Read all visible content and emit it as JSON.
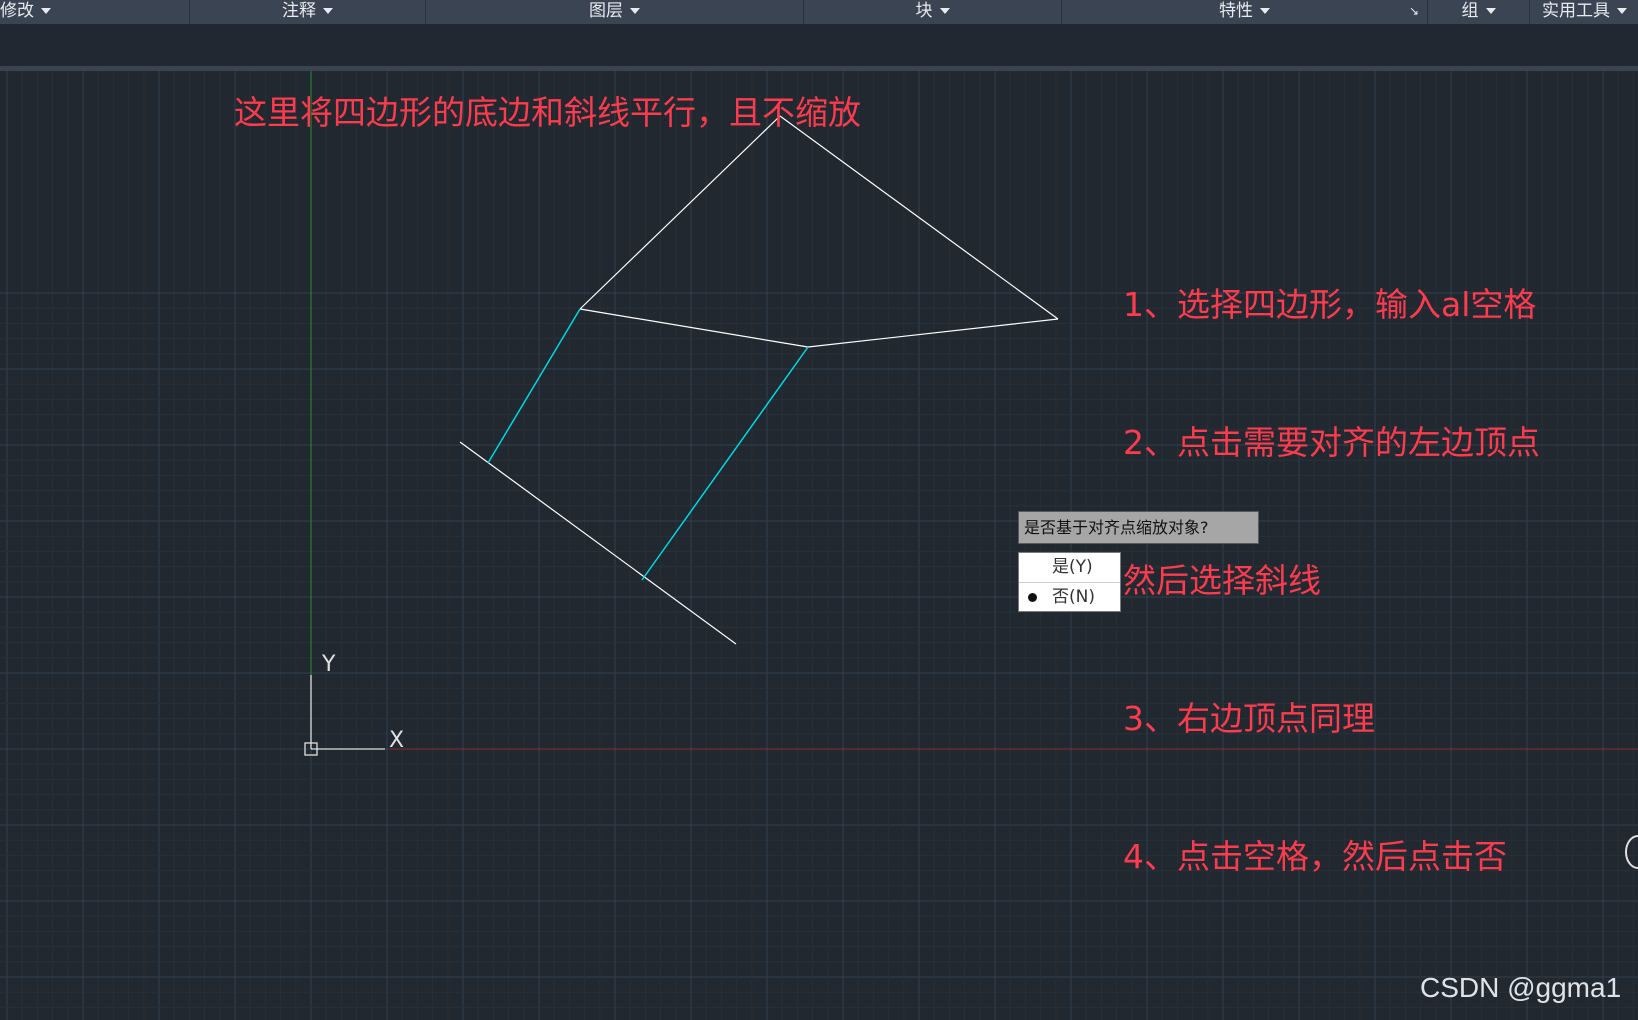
{
  "ribbon": {
    "panels": [
      {
        "label": "修改"
      },
      {
        "label": "注释"
      },
      {
        "label": "图层"
      },
      {
        "label": "块"
      },
      {
        "label": "特性"
      },
      {
        "label": "组"
      },
      {
        "label": "实用工具"
      }
    ],
    "launcher_icon": "dialog-launcher-icon"
  },
  "annotations": {
    "title": "这里将四边形的底边和斜线平行，且不缩放",
    "steps": [
      "1、选择四边形，输入al空格",
      "2、点击需要对齐的左边顶点",
      "然后选择斜线",
      "3、右边顶点同理",
      "4、点击空格，然后点击否"
    ]
  },
  "ucs": {
    "y_label": "Y",
    "x_label": "X"
  },
  "prompt": {
    "question": "是否基于对齐点缩放对象?",
    "options": [
      {
        "label": "是(Y)",
        "selected": false
      },
      {
        "label": "否(N)",
        "selected": true
      }
    ]
  },
  "watermark": "CSDN @ggma1",
  "colors": {
    "background": "#212830",
    "annotation": "#ff3b4e",
    "geometry": "#ffffff",
    "helper_lines": "#00d8e0",
    "x_axis": "#8b2a2a",
    "y_axis": "#2e8b2e"
  }
}
